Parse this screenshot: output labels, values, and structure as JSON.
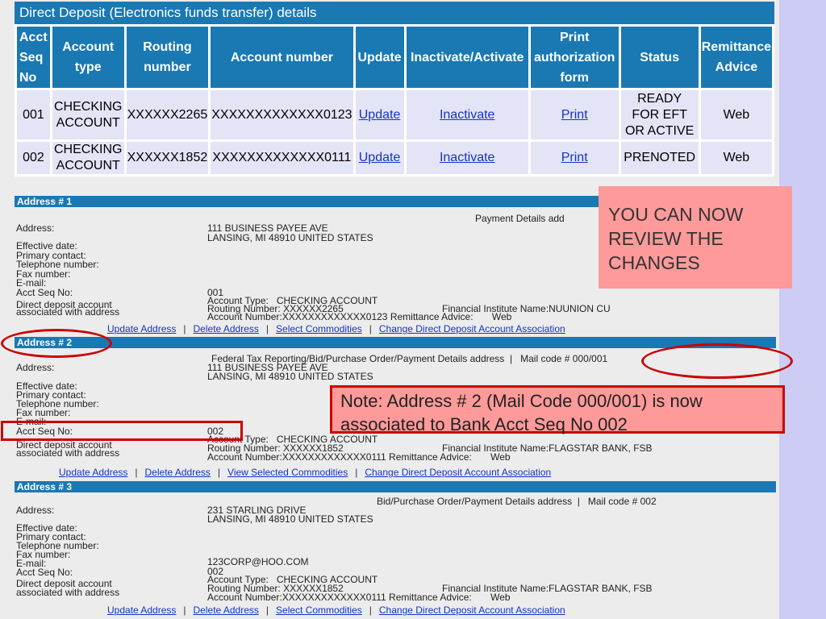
{
  "deposit": {
    "title": "Direct Deposit (Electronics funds transfer) details",
    "headers": {
      "seq": [
        "Acct",
        "Seq",
        "No"
      ],
      "type": [
        "Account",
        "type"
      ],
      "routing": [
        "Routing",
        "number"
      ],
      "account": "Account number",
      "update": "Update",
      "inactivate": "Inactivate/Activate",
      "print": [
        "Print",
        "authorization",
        "form"
      ],
      "status": "Status",
      "remit": [
        "Remittance",
        "Advice"
      ]
    },
    "rows": [
      {
        "seq": "001",
        "type": [
          "CHECKING",
          "ACCOUNT"
        ],
        "routing": "XXXXXX2265",
        "account": "XXXXXXXXXXXXX0123",
        "update": "Update",
        "inactivate": "Inactivate",
        "print": "Print",
        "status": [
          "READY",
          "FOR EFT",
          "OR ACTIVE"
        ],
        "remit": "Web"
      },
      {
        "seq": "002",
        "type": [
          "CHECKING",
          "ACCOUNT"
        ],
        "routing": "XXXXXX1852",
        "account": "XXXXXXXXXXXXX0111",
        "update": "Update",
        "inactivate": "Inactivate",
        "print": "Print",
        "status": [
          "PRENOTED"
        ],
        "remit": "Web"
      }
    ]
  },
  "labels": {
    "address": "Address:",
    "effective": "Effective date:",
    "primary": "Primary contact:",
    "telephone": "Telephone number:",
    "fax": "Fax number:",
    "email": "E-mail:",
    "seq": "Acct Seq No:",
    "dd1": "Direct deposit account",
    "dd2": "associated with address",
    "acct_type": "Account Type:",
    "routing": "Routing Number:",
    "acct_num": "Account Number:",
    "fin_inst": "Financial Institute Name:",
    "remit": "Remittance Advice:"
  },
  "addresses": [
    {
      "title": "Address # 1",
      "purpose": "Payment Details add",
      "line1": "111 BUSINESS PAYEE AVE",
      "line2": "LANSING, MI 48910 UNITED STATES",
      "email": "",
      "seq": "001",
      "acct_type": "CHECKING ACCOUNT",
      "routing": "XXXXXX2265",
      "acct_num": "XXXXXXXXXXXXX0123",
      "fin_inst": "NUUNION CU",
      "remit": "Web",
      "links": [
        "Update Address",
        "Delete Address",
        "Select Commodities",
        "Change Direct Deposit Account Association"
      ]
    },
    {
      "title": "Address # 2",
      "purpose": "Federal Tax Reporting/Bid/Purchase Order/Payment Details address",
      "mail_code": "Mail code # 000/001",
      "line1": "111 BUSINESS PAYEE AVE",
      "line2": "LANSING, MI 48910 UNITED STATES",
      "email": "",
      "seq": "002",
      "acct_type": "CHECKING ACCOUNT",
      "routing": "XXXXXX1852",
      "acct_num": "XXXXXXXXXXXXX0111",
      "fin_inst": "FLAGSTAR BANK, FSB",
      "remit": "Web",
      "links": [
        "Update Address",
        "Delete Address",
        "View Selected Commodities",
        "Change Direct Deposit Account Association"
      ]
    },
    {
      "title": "Address # 3",
      "purpose": "Bid/Purchase Order/Payment Details address",
      "mail_code": "Mail code # 002",
      "line1": "231 STARLING DRIVE",
      "line2": "LANSING, MI 48910 UNITED STATES",
      "email": "123CORP@HOO.COM",
      "seq": "002",
      "acct_type": "CHECKING ACCOUNT",
      "routing": "XXXXXX1852",
      "acct_num": "XXXXXXXXXXXXX0111",
      "fin_inst": "FLAGSTAR BANK, FSB",
      "remit": "Web",
      "links": [
        "Update Address",
        "Delete Address",
        "Select Commodities",
        "Change Direct Deposit Account Association"
      ]
    }
  ],
  "separator": "|",
  "callouts": {
    "review": [
      "YOU CAN NOW",
      "REVIEW THE",
      "CHANGES"
    ],
    "note": [
      "Note:  Address # 2 (Mail Code 000/001) is now",
      "associated to Bank Acct Seq No 002"
    ]
  },
  "colors": {
    "header_blue": "#1a78b3",
    "callout_fill": "#ff9a9a",
    "highlight_red": "#cc0000",
    "link_blue": "#1533c5"
  }
}
